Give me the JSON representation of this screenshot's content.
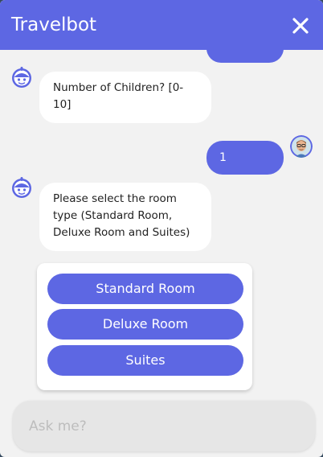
{
  "header": {
    "title": "Travelbot",
    "close_icon": "close-icon"
  },
  "colors": {
    "accent": "#5d67e3",
    "background": "#f2f2f2",
    "page_backdrop": "#34495e"
  },
  "messages": {
    "bot_children_question": "Number of Children? [0-10]",
    "user_children_answer": "1",
    "bot_room_question": "Please select the room type (Standard Room, Deluxe Room and Suites)"
  },
  "room_options": [
    {
      "label": "Standard Room"
    },
    {
      "label": "Deluxe Room"
    },
    {
      "label": "Suites"
    }
  ],
  "input": {
    "placeholder": "Ask me?"
  },
  "icons": {
    "bot_avatar": "robot-avatar-icon",
    "user_avatar": "user-avatar"
  }
}
